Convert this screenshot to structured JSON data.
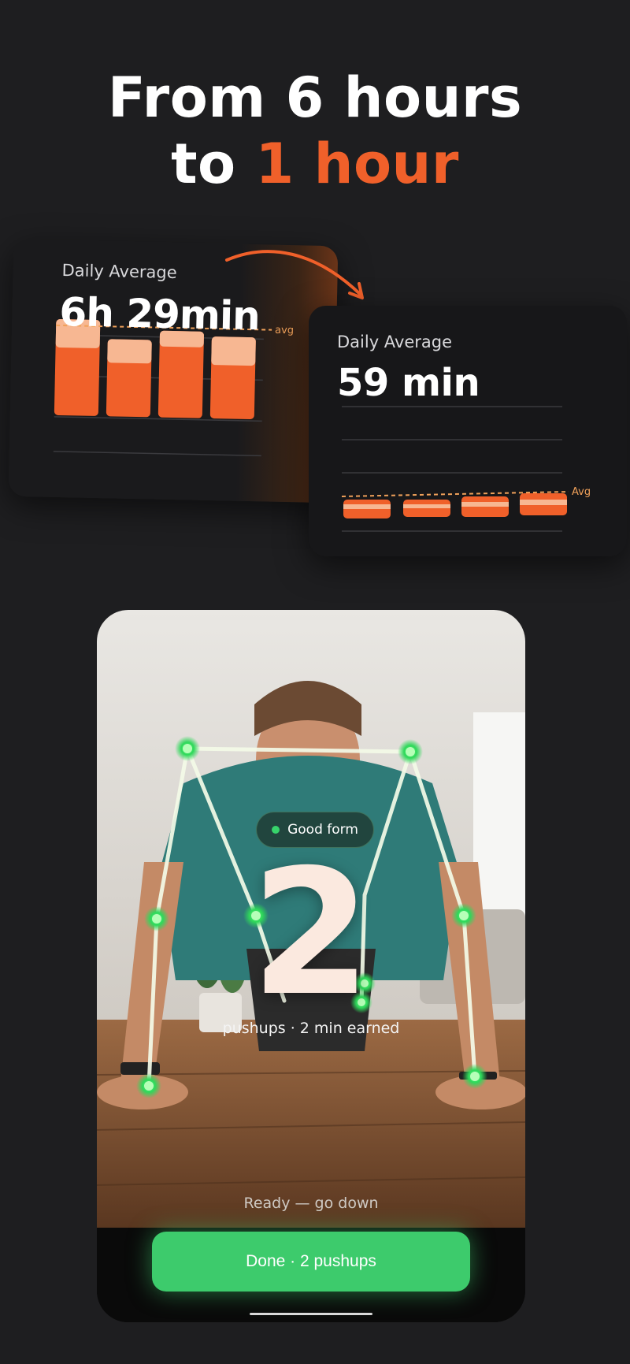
{
  "headline": {
    "line1": "From 6 hours",
    "line2_prefix": "to ",
    "line2_accent": "1 hour"
  },
  "colors": {
    "accent": "#f0602a",
    "success": "#3dcb6c",
    "background": "#1e1e20"
  },
  "before_card": {
    "label": "Daily Average",
    "value": "6h 29min",
    "avg_label": "avg",
    "bars": 4
  },
  "after_card": {
    "label": "Daily Average",
    "value": "59 min",
    "avg_label": "Avg",
    "bars": 4
  },
  "camera": {
    "badge": "Good form",
    "rep_count": "2",
    "rep_caption": "pushups · 2 min earned",
    "status": "Ready — go down",
    "done_button": "Done · 2 pushups"
  }
}
